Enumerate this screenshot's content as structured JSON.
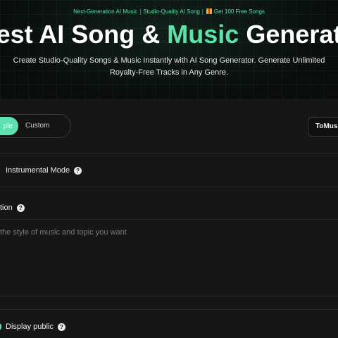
{
  "hero": {
    "badge_part1": "Next-Generation AI Music",
    "badge_sep": "|",
    "badge_part2": "Studio-Quality AI Song",
    "badge_part3": "Get 100 Free Songs",
    "gift_icon": "gift-icon",
    "title_before": "est AI Song & ",
    "title_accent": "Music",
    "title_after": " Generat",
    "subtitle_line1": "Create Studio-Quality Songs & Music Instantly with AI Song Generator. Generate Unlimited",
    "subtitle_line2": "Royalty-Free Tracks in Any Genre."
  },
  "controls": {
    "mode_simple": "ple",
    "mode_custom": "Custom",
    "model_select": "ToMusi"
  },
  "form": {
    "instrumental_label": "Instrumental Mode",
    "description_label": "tion",
    "description_placeholder": "the style of music and topic you want",
    "display_public_label": "Display public",
    "help_icon": "?"
  },
  "colors": {
    "accent": "#5fe0a8",
    "toggle_active": "#5fe0b0",
    "background": "#161616"
  }
}
